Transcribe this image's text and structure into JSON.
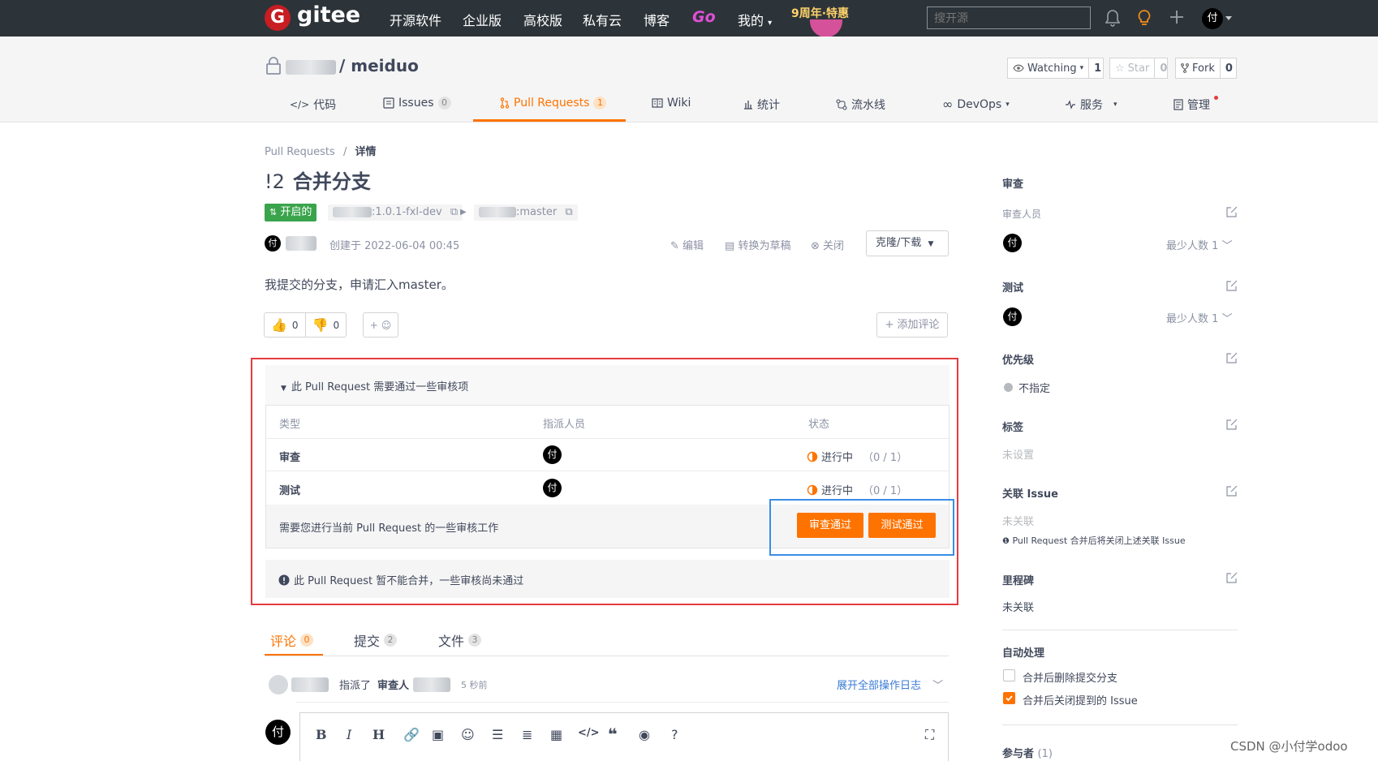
{
  "topnav": {
    "logo": "gitee",
    "links": [
      "开源软件",
      "企业版",
      "高校版",
      "私有云",
      "博客"
    ],
    "go": "Go",
    "mine": "我的",
    "promo": "9周年·特惠",
    "search_placeholder": "搜开源",
    "avatar": "付"
  },
  "repo": {
    "name": "/ meiduo",
    "watch": {
      "label": "Watching",
      "count": "1"
    },
    "star": {
      "label": "Star",
      "count": "0"
    },
    "fork": {
      "label": "Fork",
      "count": "0"
    },
    "tabs": [
      {
        "label": "代码"
      },
      {
        "label": "Issues",
        "count": "0"
      },
      {
        "label": "Pull Requests",
        "count": "1"
      },
      {
        "label": "Wiki"
      },
      {
        "label": "统计"
      },
      {
        "label": "流水线"
      },
      {
        "label": "DevOps"
      },
      {
        "label": "服务"
      },
      {
        "label": "管理"
      }
    ]
  },
  "pr": {
    "breadcrumb": {
      "parent": "Pull Requests",
      "sep": "/",
      "current": "详情"
    },
    "number": "!2",
    "title": "合并分支",
    "state": "开启的",
    "source_branch": ":1.0.1-fxl-dev",
    "target_branch": ":master",
    "author_avatar": "付",
    "created": "创建于 2022-06-04 00:45",
    "actions": {
      "edit": "编辑",
      "draft": "转换为草稿",
      "close": "关闭",
      "clone": "克隆/下载"
    },
    "description": "我提交的分支，申请汇入master。",
    "reactions": {
      "up": "0",
      "down": "0",
      "add": "+"
    },
    "add_comment": "+ 添加评论"
  },
  "review": {
    "header": "此 Pull Request 需要通过一些审核项",
    "columns": [
      "类型",
      "指派人员",
      "状态"
    ],
    "rows": [
      {
        "type": "审查",
        "assignee": "付",
        "status": "进行中",
        "progress": "（0 / 1）"
      },
      {
        "type": "测试",
        "assignee": "付",
        "status": "进行中",
        "progress": "（0 / 1）"
      }
    ],
    "footer_text": "需要您进行当前 Pull Request 的一些审核工作",
    "approve_review": "审查通过",
    "approve_test": "测试通过",
    "warning": "此 Pull Request 暂不能合并，一些审核尚未通过"
  },
  "bottom": {
    "tabs": [
      {
        "label": "评论",
        "count": "0"
      },
      {
        "label": "提交",
        "count": "2"
      },
      {
        "label": "文件",
        "count": "3"
      }
    ],
    "log": {
      "action": "指派了",
      "role": "审查人",
      "time": "5 秒前",
      "expand": "展开全部操作日志"
    },
    "avatar": "付",
    "toolbar": [
      "B",
      "I",
      "H"
    ]
  },
  "sidebar": {
    "review": {
      "title": "审查",
      "sub": "审查人员",
      "avatar": "付",
      "min": "最少人数 1"
    },
    "test": {
      "title": "测试",
      "avatar": "付",
      "min": "最少人数 1"
    },
    "priority": {
      "title": "优先级",
      "value": "不指定"
    },
    "labels": {
      "title": "标签",
      "value": "未设置"
    },
    "issue": {
      "title": "关联 Issue",
      "value": "未关联",
      "note": "Pull Request 合并后将关闭上述关联 Issue"
    },
    "milestone": {
      "title": "里程碑",
      "value": "未关联"
    },
    "auto": {
      "title": "自动处理",
      "opt1": "合并后删除提交分支",
      "opt2": "合并后关闭提到的 Issue"
    },
    "participants": {
      "title": "参与者",
      "count": "(1)"
    }
  },
  "watermark": "CSDN @小付学odoo",
  "colors": {
    "accent": "#fe7300",
    "open": "#3aa44c",
    "red_box": "#e43b3f",
    "blue_box": "#3a8ee6",
    "nav": "#2d3439"
  }
}
